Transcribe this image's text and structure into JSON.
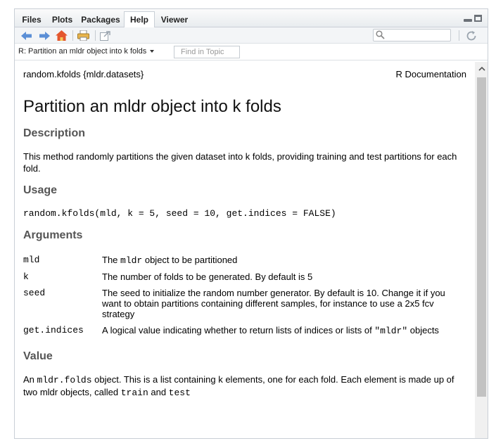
{
  "tabs": [
    {
      "label": "Files",
      "active": false
    },
    {
      "label": "Plots",
      "active": false
    },
    {
      "label": "Packages",
      "active": false
    },
    {
      "label": "Help",
      "active": true
    },
    {
      "label": "Viewer",
      "active": false
    }
  ],
  "toolbar": {
    "icons": [
      "back-arrow-icon",
      "forward-arrow-icon",
      "home-icon",
      "print-icon",
      "popout-icon",
      "refresh-icon"
    ],
    "search_placeholder": ""
  },
  "topic": {
    "selected": "R: Partition an mldr object into k folds",
    "find_placeholder": "Find in Topic"
  },
  "doc": {
    "header_left": "random.kfolds {mldr.datasets}",
    "header_right": "R Documentation",
    "title": "Partition an mldr object into k folds",
    "description_heading": "Description",
    "description_text": "This method randomly partitions the given dataset into k folds, providing training and test partitions for each fold.",
    "usage_heading": "Usage",
    "usage_code": "random.kfolds(mld, k = 5, seed = 10, get.indices = FALSE)",
    "arguments_heading": "Arguments",
    "arguments": [
      {
        "name": "mld",
        "pre": "The ",
        "code": "mldr",
        "post": " object to be partitioned"
      },
      {
        "name": "k",
        "pre": "The number of folds to be generated. By default is 5",
        "code": "",
        "post": ""
      },
      {
        "name": "seed",
        "pre": "The seed to initialize the random number generator. By default is 10. Change it if you want to obtain partitions containing different samples, for instance to use a 2x5 fcv strategy",
        "code": "",
        "post": ""
      },
      {
        "name": "get.indices",
        "pre": "A logical value indicating whether to return lists of indices or lists of ",
        "code": "\"mldr\"",
        "post": " objects"
      }
    ],
    "value_heading": "Value",
    "value_parts": [
      {
        "t": "An ",
        "code": false
      },
      {
        "t": "mldr.folds",
        "code": true
      },
      {
        "t": " object. This is a list containing k elements, one for each fold. Each element is made up of two mldr objects, called ",
        "code": false
      },
      {
        "t": "train",
        "code": true
      },
      {
        "t": " and ",
        "code": false
      },
      {
        "t": "test",
        "code": true
      }
    ]
  },
  "colors": {
    "heading": "#555555",
    "nav_arrow": "#5b8fd6",
    "home": "#e4572e",
    "scroll_thumb": "#c2c2c2"
  }
}
